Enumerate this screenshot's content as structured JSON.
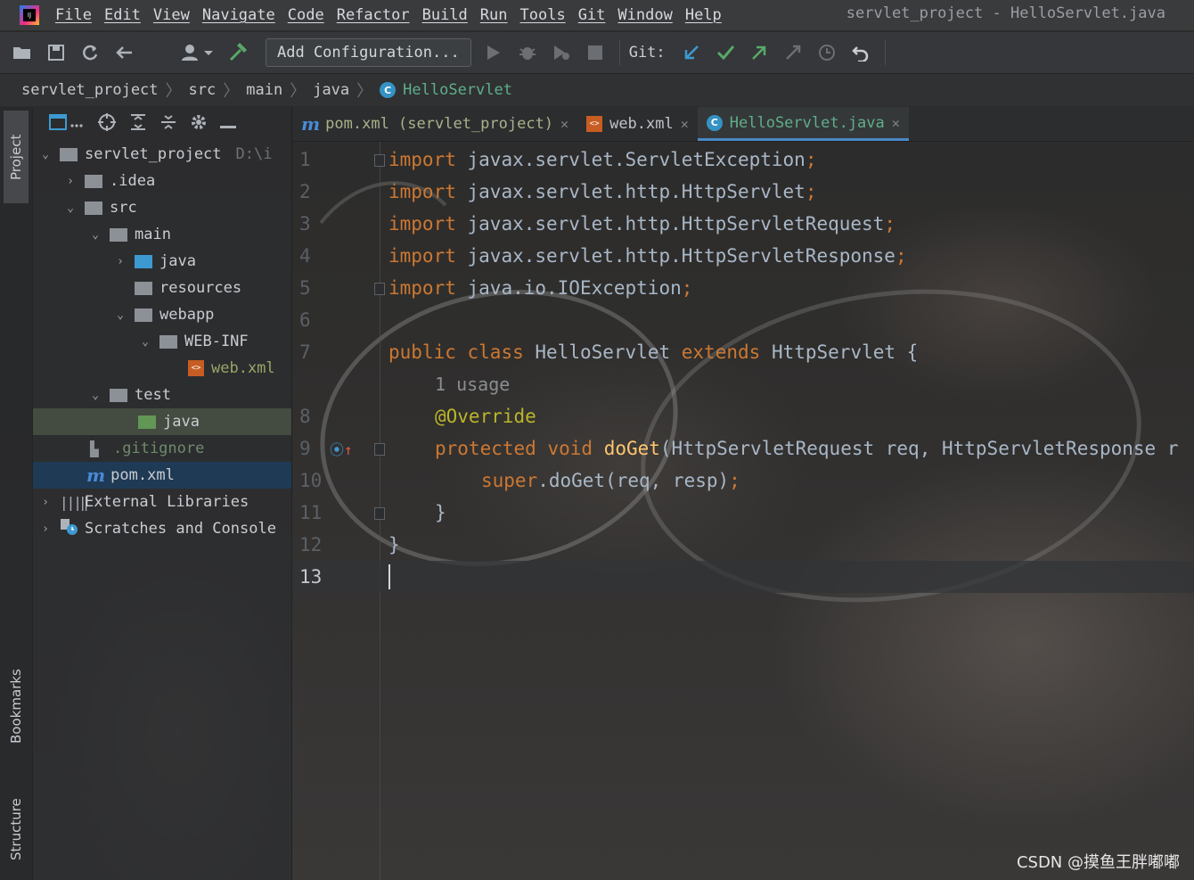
{
  "menu": {
    "items": [
      "File",
      "Edit",
      "View",
      "Navigate",
      "Code",
      "Refactor",
      "Build",
      "Run",
      "Tools",
      "Git",
      "Window",
      "Help"
    ],
    "window_title": "servlet_project - HelloServlet.java"
  },
  "toolbar": {
    "config_label": "Add Configuration...",
    "git_label": "Git:"
  },
  "breadcrumb": {
    "items": [
      "servlet_project",
      "src",
      "main",
      "java"
    ],
    "current": "HelloServlet"
  },
  "left_strip": {
    "project": "Project",
    "bookmarks": "Bookmarks",
    "structure": "Structure"
  },
  "tree": {
    "root": "servlet_project",
    "root_path": "D:\\i",
    "idea": ".idea",
    "src": "src",
    "main": "main",
    "java": "java",
    "resources": "resources",
    "webapp": "webapp",
    "webinf": "WEB-INF",
    "webxml": "web.xml",
    "test": "test",
    "test_java": "java",
    "gitignore": ".gitignore",
    "pom": "pom.xml",
    "external": "External Libraries",
    "scratches": "Scratches and Console"
  },
  "tabs": [
    {
      "label": "pom.xml (servlet_project)"
    },
    {
      "label": "web.xml"
    },
    {
      "label": "HelloServlet.java"
    }
  ],
  "code": {
    "line_numbers": [
      "1",
      "2",
      "3",
      "4",
      "5",
      "6",
      "7",
      "8",
      "9",
      "10",
      "11",
      "12",
      "13"
    ],
    "import_kw": "import",
    "imports": [
      "javax.servlet.ServletException",
      "javax.servlet.http.HttpServlet",
      "javax.servlet.http.HttpServletRequest",
      "javax.servlet.http.HttpServletResponse",
      "java.io.IOException"
    ],
    "semicolon": ";",
    "public_kw": "public",
    "class_kw": "class",
    "class_name": "HelloServlet",
    "extends_kw": "extends",
    "super_class": "HttpServlet",
    "open_brace": "{",
    "usage_hint": "1 usage",
    "override": "@Override",
    "protected_kw": "protected",
    "void_kw": "void",
    "method_name": "doGet",
    "params": "(HttpServletRequest req, HttpServletResponse r",
    "super_kw": "super",
    "super_call": ".doGet(req, resp)",
    "close_brace": "}"
  },
  "watermark": "CSDN @摸鱼王胖嘟嘟"
}
